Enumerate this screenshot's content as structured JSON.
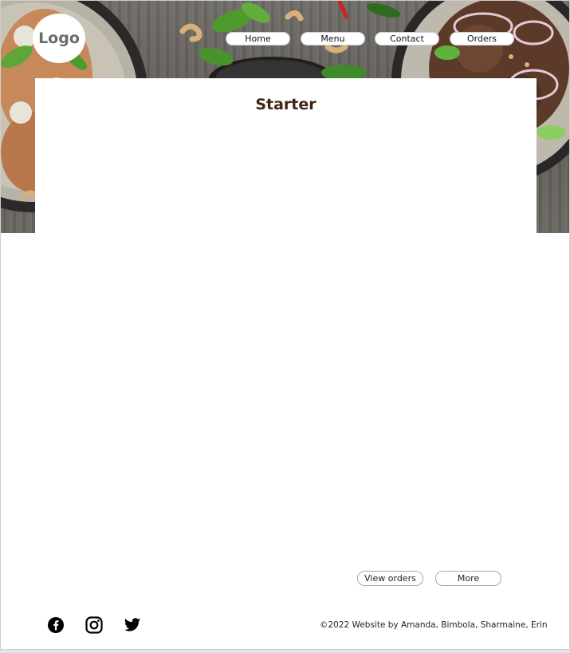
{
  "header": {
    "logo_text": "Logo",
    "nav": [
      {
        "label": "Home"
      },
      {
        "label": "Menu"
      },
      {
        "label": "Contact"
      },
      {
        "label": "Orders"
      }
    ]
  },
  "hero": {
    "image": "food-photo-banner"
  },
  "main": {
    "title": "Starter"
  },
  "actions": {
    "view_orders_label": "View orders",
    "more_label": "More"
  },
  "footer": {
    "social": [
      {
        "icon": "facebook-icon"
      },
      {
        "icon": "instagram-icon"
      },
      {
        "icon": "twitter-icon"
      }
    ],
    "copyright": "©2022 Website by Amanda, Bimbola, Sharmaine, Erin"
  },
  "colors": {
    "title": "#3e2415",
    "page_background": "#ffffff",
    "button_border": "#a9a9a9"
  }
}
